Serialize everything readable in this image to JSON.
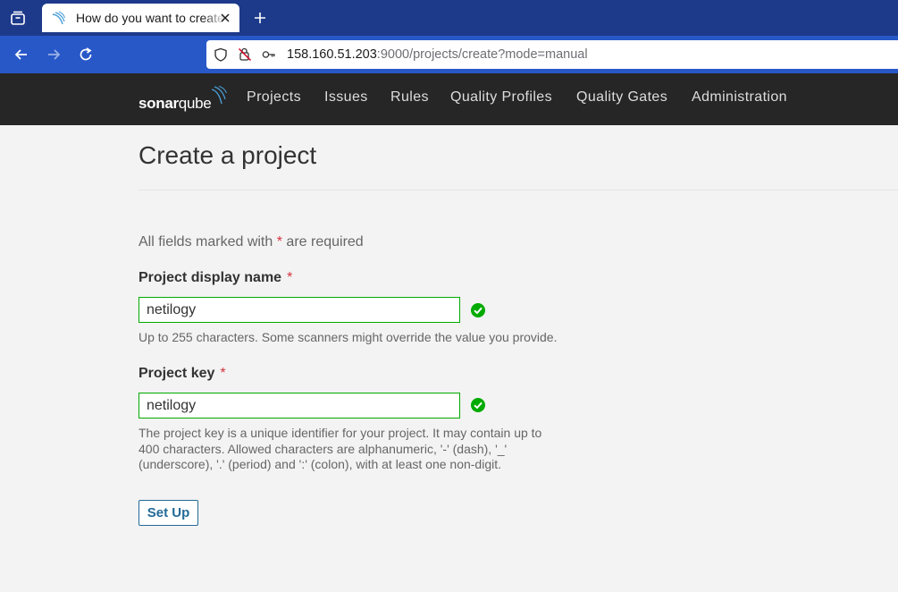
{
  "browser": {
    "tab_title": "How do you want to create",
    "url_host": "158.160.51.203",
    "url_rest": ":9000/projects/create?mode=manual"
  },
  "app": {
    "logo_bold": "sonar",
    "logo_thin": "qube",
    "menu": [
      "Projects",
      "Issues",
      "Rules",
      "Quality Profiles",
      "Quality Gates",
      "Administration"
    ]
  },
  "form": {
    "page_title": "Create a project",
    "required_note_before": "All fields marked with",
    "required_marker": "*",
    "required_note_after": "are required",
    "display_name": {
      "label": "Project display name",
      "value": "netilogy",
      "help": "Up to 255 characters. Some scanners might override the value you provide."
    },
    "project_key": {
      "label": "Project key",
      "value": "netilogy",
      "help_lines": [
        "The project key is a unique identifier for your project. It may contain up to",
        "400 characters. Allowed characters are alphanumeric, '-' (dash), '_'",
        "(underscore), '.' (period) and ':' (colon), with at least one non-digit."
      ]
    },
    "submit_label": "Set Up"
  },
  "colors": {
    "tabbar": "#1d3a8a",
    "navbar": "#2858c8",
    "sq_nav": "#262626",
    "valid_green": "#00aa00",
    "required_red": "#d4333f",
    "button_blue": "#236a97"
  },
  "icons": [
    "tab-list-icon",
    "favicon-icon",
    "close-icon",
    "plus-icon",
    "back-icon",
    "forward-icon",
    "reload-icon",
    "shield-icon",
    "no-camera-icon",
    "key-icon",
    "check-circle-icon"
  ]
}
